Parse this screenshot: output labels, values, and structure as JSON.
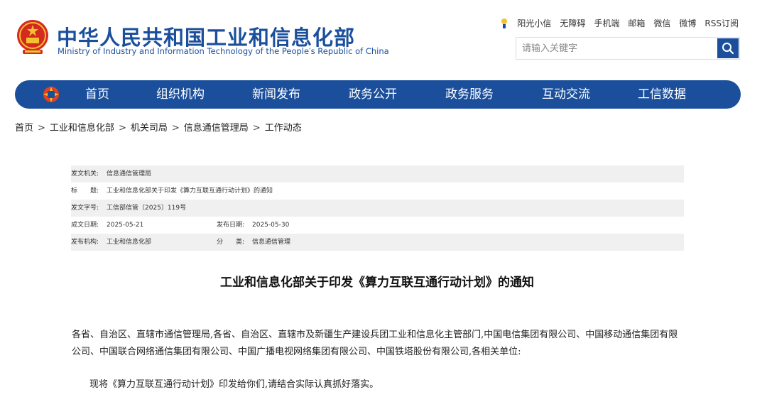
{
  "header": {
    "site_title": "中华人民共和国工业和信息化部",
    "site_subtitle": "Ministry of Industry and Information Technology of the People′s Republic of China",
    "top_links": [
      "阳光小信",
      "无障碍",
      "手机端",
      "邮箱",
      "微信",
      "微博",
      "RSS订阅"
    ],
    "search_placeholder": "请输入关键字",
    "brand_color": "#1b4f9c"
  },
  "nav": {
    "items": [
      "首页",
      "组织机构",
      "新闻发布",
      "政务公开",
      "政务服务",
      "互动交流",
      "工信数据"
    ]
  },
  "breadcrumb": [
    "首页",
    "工业和信息化部",
    "机关司局",
    "信息通信管理局",
    "工作动态"
  ],
  "meta": {
    "issuer_label": "发文机关:",
    "issuer": "信息通信管理局",
    "title_label": "标　　题:",
    "title": "工业和信息化部关于印发《算力互联互通行动计划》的通知",
    "doc_no_label": "发文字号:",
    "doc_no": "工信部信管〔2025〕119号",
    "created_label": "成文日期:",
    "created": "2025-05-21",
    "published_label": "发布日期:",
    "published": "2025-05-30",
    "org_label": "发布机构:",
    "org": "工业和信息化部",
    "category_label": "分　　类:",
    "category": "信息通信管理"
  },
  "document": {
    "title": "工业和信息化部关于印发《算力互联互通行动计划》的通知",
    "para1_line1": "各省、自治区、直辖市通信管理局,各省、自治区、直辖市及新疆生产建设兵团工业和信息化主管部门,中国电信集团有限公司、中国移动通信集团有限",
    "para1_line2": "公司、中国联合网络通信集团有限公司、中国广播电视网络集团有限公司、中国铁塔股份有限公司,各相关单位:",
    "para2": "现将《算力互联互通行动计划》印发给你们,请结合实际认真抓好落实。"
  }
}
